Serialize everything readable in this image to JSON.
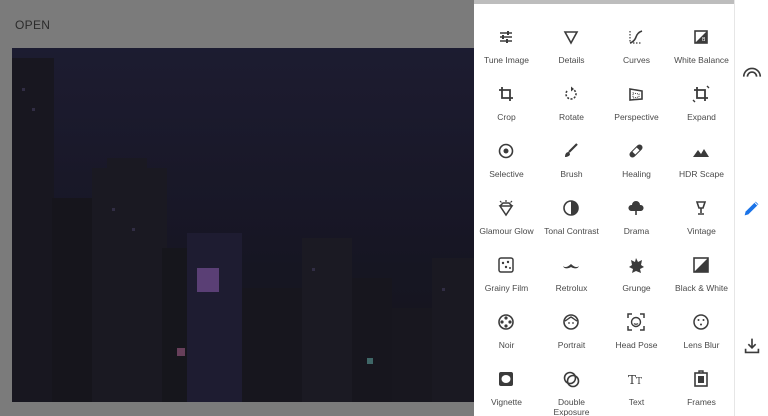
{
  "header": {
    "open_label": "OPEN"
  },
  "colors": {
    "accent": "#1a73e8",
    "icon": "#3b3b3b",
    "label": "#4a4a4a"
  },
  "tools": [
    {
      "label": "Tune Image",
      "icon": "tune-icon"
    },
    {
      "label": "Details",
      "icon": "triangle-icon"
    },
    {
      "label": "Curves",
      "icon": "curves-icon"
    },
    {
      "label": "White Balance",
      "icon": "wb-icon"
    },
    {
      "label": "Crop",
      "icon": "crop-icon"
    },
    {
      "label": "Rotate",
      "icon": "rotate-icon"
    },
    {
      "label": "Perspective",
      "icon": "perspective-icon"
    },
    {
      "label": "Expand",
      "icon": "expand-icon"
    },
    {
      "label": "Selective",
      "icon": "target-icon"
    },
    {
      "label": "Brush",
      "icon": "brush-icon"
    },
    {
      "label": "Healing",
      "icon": "bandage-icon"
    },
    {
      "label": "HDR Scape",
      "icon": "mountains-icon"
    },
    {
      "label": "Glamour Glow",
      "icon": "diamond-icon"
    },
    {
      "label": "Tonal Contrast",
      "icon": "half-circle-icon"
    },
    {
      "label": "Drama",
      "icon": "cloud-icon"
    },
    {
      "label": "Vintage",
      "icon": "lamp-icon"
    },
    {
      "label": "Grainy Film",
      "icon": "grain-icon"
    },
    {
      "label": "Retrolux",
      "icon": "mustache-icon"
    },
    {
      "label": "Grunge",
      "icon": "grunge-icon"
    },
    {
      "label": "Black & White",
      "icon": "bw-icon"
    },
    {
      "label": "Noir",
      "icon": "film-reel-icon"
    },
    {
      "label": "Portrait",
      "icon": "face-icon"
    },
    {
      "label": "Head Pose",
      "icon": "face-frame-icon"
    },
    {
      "label": "Lens Blur",
      "icon": "dotted-circle-icon"
    },
    {
      "label": "Vignette",
      "icon": "vignette-icon"
    },
    {
      "label": "Double Exposure",
      "icon": "double-circle-icon"
    },
    {
      "label": "Text",
      "icon": "text-icon"
    },
    {
      "label": "Frames",
      "icon": "frame-icon"
    }
  ],
  "rail": [
    {
      "icon": "looks-icon"
    },
    {
      "icon": "pencil-icon"
    },
    {
      "icon": "download-icon"
    }
  ]
}
